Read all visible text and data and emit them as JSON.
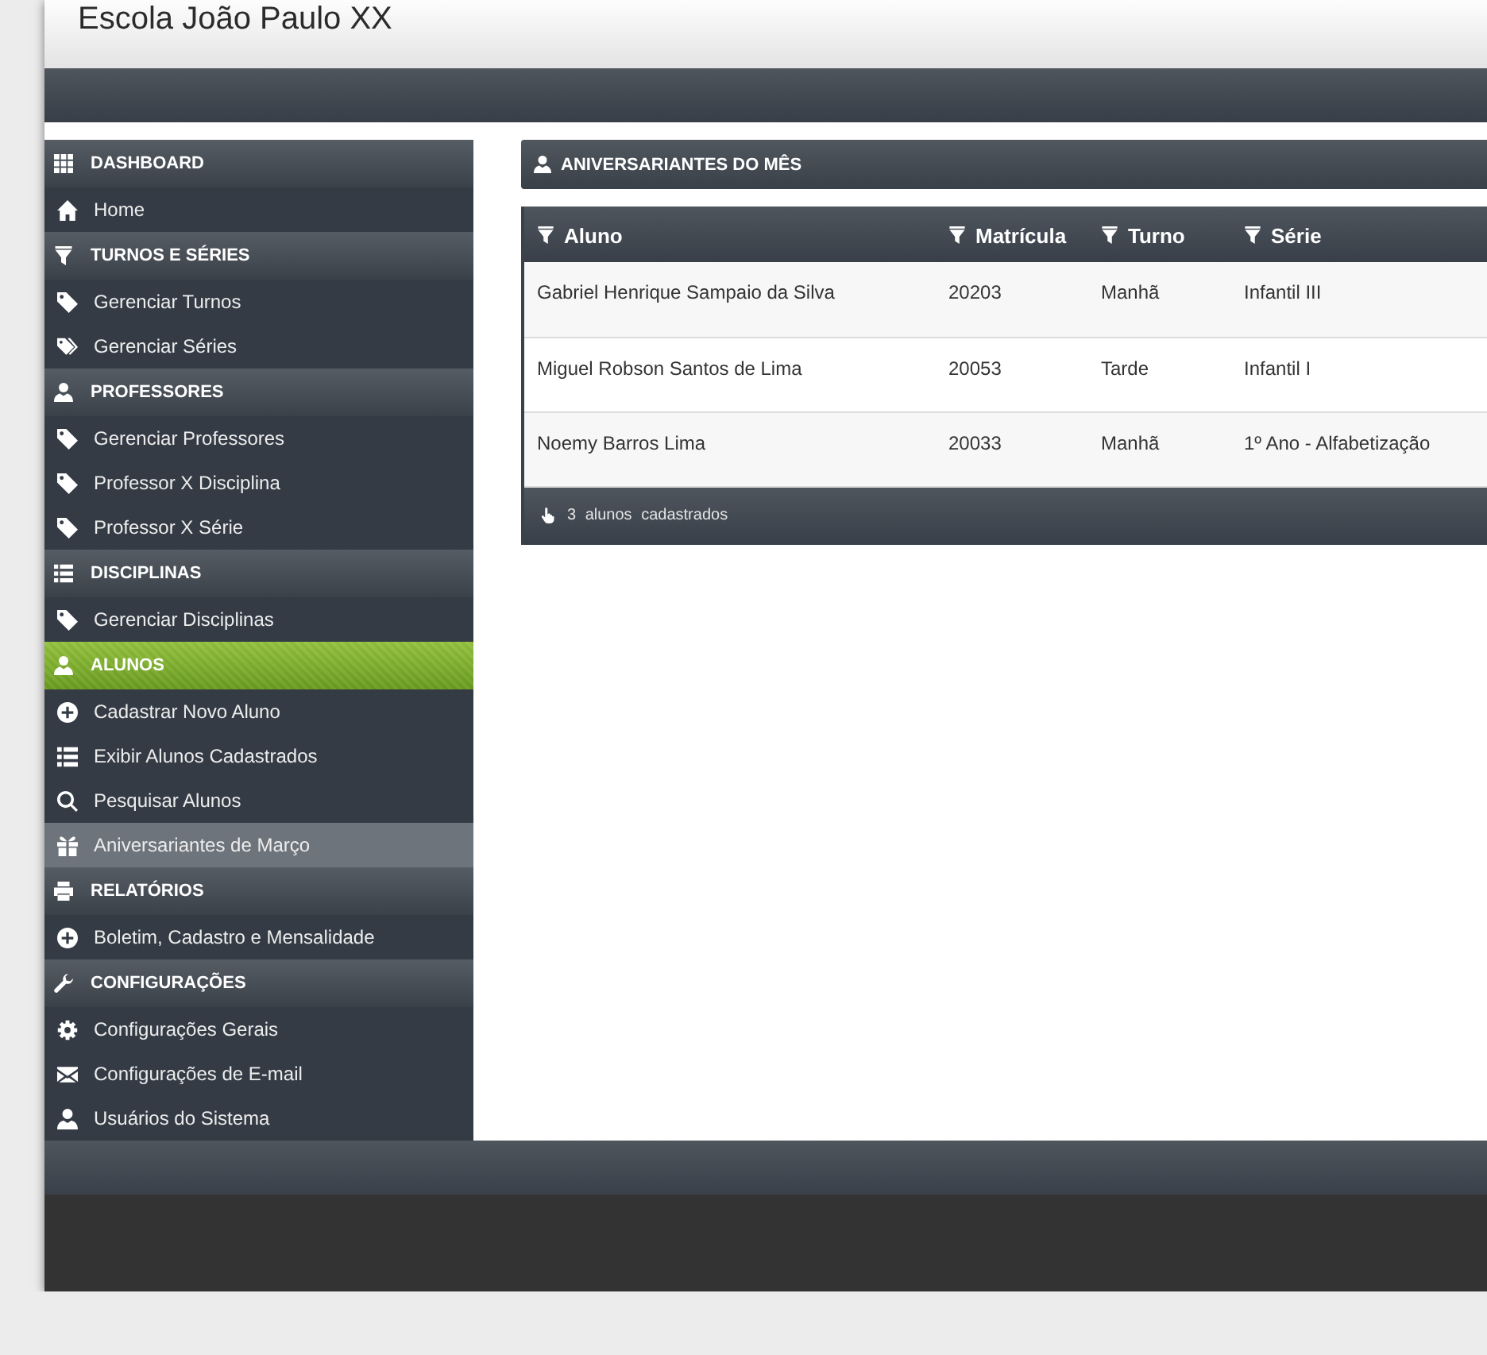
{
  "header": {
    "title": "Escola João Paulo XX"
  },
  "sidebar": {
    "sections": [
      {
        "title": "DASHBOARD",
        "selected": false,
        "items": [
          {
            "label": "Home",
            "selected": false
          }
        ]
      },
      {
        "title": "TURNOS E SÉRIES",
        "selected": false,
        "items": [
          {
            "label": "Gerenciar Turnos",
            "selected": false
          },
          {
            "label": "Gerenciar Séries",
            "selected": false
          }
        ]
      },
      {
        "title": "PROFESSORES",
        "selected": false,
        "items": [
          {
            "label": "Gerenciar Professores",
            "selected": false
          },
          {
            "label": "Professor X Disciplina",
            "selected": false
          },
          {
            "label": "Professor X Série",
            "selected": false
          }
        ]
      },
      {
        "title": "DISCIPLINAS",
        "selected": false,
        "items": [
          {
            "label": "Gerenciar Disciplinas",
            "selected": false
          }
        ]
      },
      {
        "title": "ALUNOS",
        "selected": true,
        "items": [
          {
            "label": "Cadastrar Novo Aluno",
            "selected": false
          },
          {
            "label": "Exibir Alunos Cadastrados",
            "selected": false
          },
          {
            "label": "Pesquisar Alunos",
            "selected": false
          },
          {
            "label": "Aniversariantes de Março",
            "selected": true
          }
        ]
      },
      {
        "title": "RELATÓRIOS",
        "selected": false,
        "items": [
          {
            "label": "Boletim, Cadastro e Mensalidade",
            "selected": false
          }
        ]
      },
      {
        "title": "CONFIGURAÇÕES",
        "selected": false,
        "items": [
          {
            "label": "Configurações Gerais",
            "selected": false
          },
          {
            "label": "Configurações de E-mail",
            "selected": false
          },
          {
            "label": "Usuários do Sistema",
            "selected": false
          }
        ]
      }
    ]
  },
  "panel": {
    "title": "ANIVERSARIANTES DO MÊS"
  },
  "table": {
    "columns": [
      "Aluno",
      "Matrícula",
      "Turno",
      "Série"
    ],
    "rows": [
      [
        "Gabriel Henrique Sampaio da Silva",
        "20203",
        "Manhã",
        "Infantil III"
      ],
      [
        "Miguel Robson Santos de Lima",
        "20053",
        "Tarde",
        "Infantil I"
      ],
      [
        "Noemy Barros Lima",
        "20033",
        "Manhã",
        "1º Ano - Alfabetização"
      ]
    ],
    "footer": "3 alunos cadastrados"
  }
}
